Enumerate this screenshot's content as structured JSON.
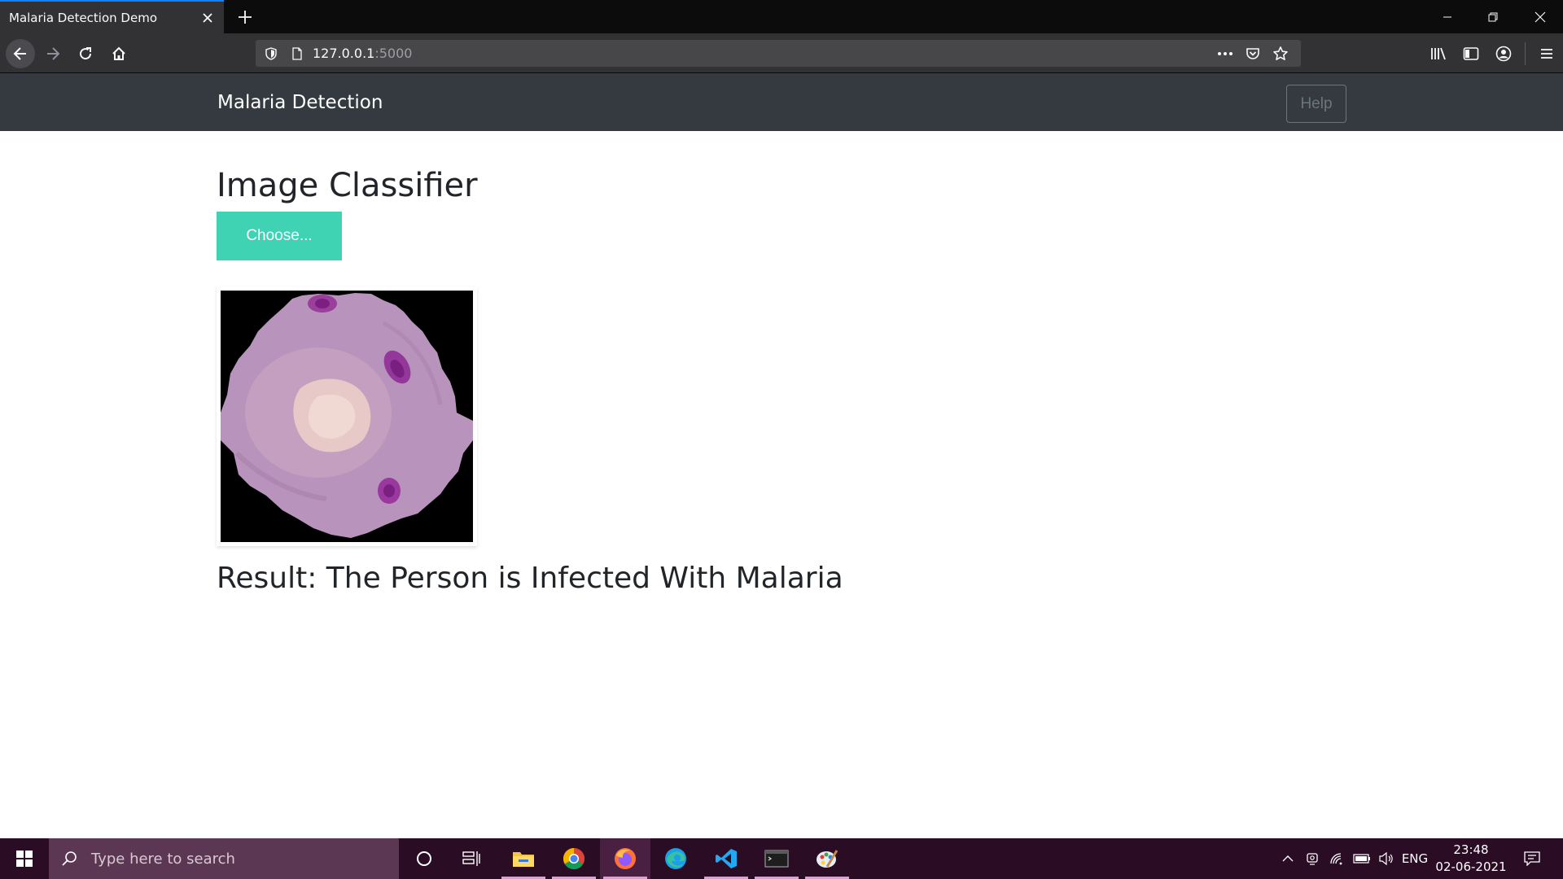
{
  "browser": {
    "tab_title": "Malaria Detection Demo",
    "url_host": "127.0.0.1",
    "url_port": ":5000"
  },
  "page": {
    "brand": "Malaria Detection",
    "help_label": "Help",
    "title": "Image Classifier",
    "choose_label": "Choose...",
    "result": "Result: The Person is Infected With Malaria"
  },
  "taskbar": {
    "search_placeholder": "Type here to search",
    "language": "ENG",
    "time": "23:48",
    "date": "02-06-2021",
    "apps": [
      "cortana",
      "task-view",
      "file-explorer",
      "chrome",
      "firefox",
      "edge",
      "vscode",
      "terminal",
      "paint"
    ]
  },
  "colors": {
    "accent_button": "#3fd2b3",
    "navbar": "#343a40",
    "taskbar": "#2a0c24"
  }
}
